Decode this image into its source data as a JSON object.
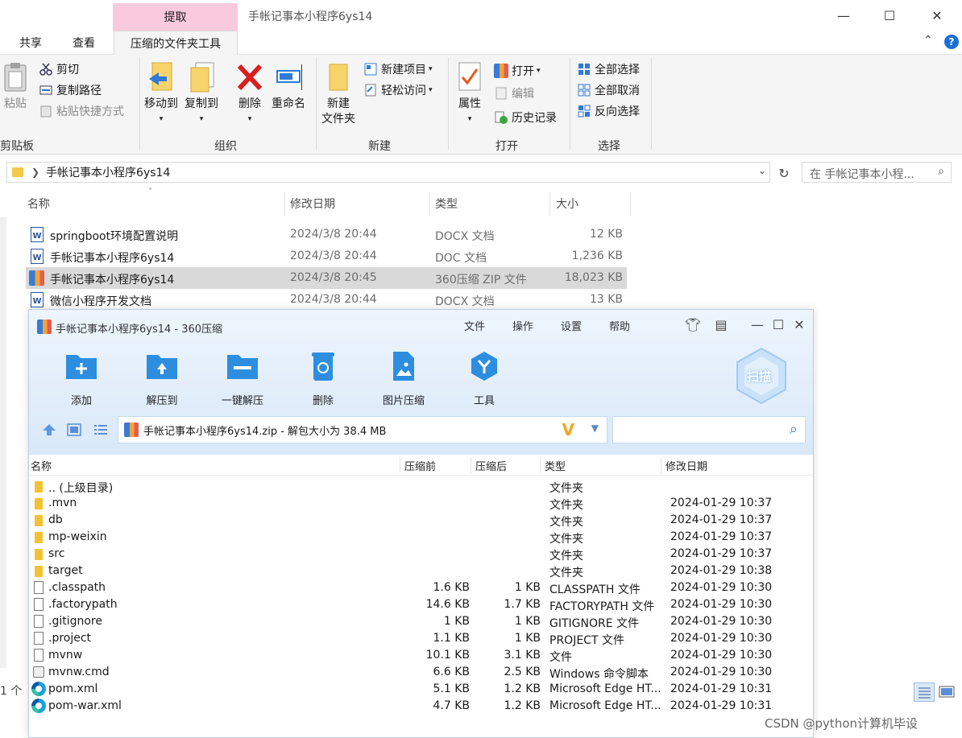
{
  "explorer": {
    "window_title": "手帐记事本小程序6ys14",
    "context_tab_header": "提取",
    "tabs": {
      "share": "共享",
      "view": "查看",
      "compressed_tools": "压缩的文件夹工具"
    },
    "ribbon": {
      "clipboard": {
        "paste": "粘贴",
        "cut": "剪切",
        "copy_path": "复制路径",
        "paste_shortcut": "粘贴快捷方式",
        "group": "剪贴板"
      },
      "organize": {
        "move_to": "移动到",
        "copy_to": "复制到",
        "delete": "删除",
        "rename": "重命名",
        "group": "组织"
      },
      "new": {
        "new_folder_line1": "新建",
        "new_folder_line2": "文件夹",
        "new_item": "新建项目",
        "easy_access": "轻松访问",
        "group": "新建"
      },
      "open": {
        "properties": "属性",
        "open": "打开",
        "edit": "编辑",
        "history": "历史记录",
        "group": "打开"
      },
      "select": {
        "select_all": "全部选择",
        "select_none": "全部取消",
        "invert": "反向选择",
        "group": "选择"
      }
    },
    "address": "手帐记事本小程序6ys14",
    "search_placeholder": "在 手帐记事本小程...",
    "columns": {
      "name": "名称",
      "modified": "修改日期",
      "type": "类型",
      "size": "大小"
    },
    "files": [
      {
        "name": "springboot环境配置说明",
        "modified": "2024/3/8 20:44",
        "type": "DOCX 文档",
        "size": "12 KB",
        "icon": "word-icon"
      },
      {
        "name": "手帐记事本小程序6ys14",
        "modified": "2024/3/8 20:44",
        "type": "DOC 文档",
        "size": "1,236 KB",
        "icon": "word-icon"
      },
      {
        "name": "手帐记事本小程序6ys14",
        "modified": "2024/3/8 20:45",
        "type": "360压缩 ZIP 文件",
        "size": "18,023 KB",
        "icon": "zip-icon",
        "selected": true
      },
      {
        "name": "微信小程序开发文档",
        "modified": "2024/3/8 20:44",
        "type": "DOCX 文档",
        "size": "13 KB",
        "icon": "word-icon"
      }
    ],
    "status_left": "1 个"
  },
  "zip": {
    "title": "手帐记事本小程序6ys14 - 360压缩",
    "menu": {
      "file": "文件",
      "operate": "操作",
      "settings": "设置",
      "help": "帮助"
    },
    "tools": {
      "add": "添加",
      "extract_to": "解压到",
      "one_click": "一键解压",
      "delete": "删除",
      "img_compress": "图片压缩",
      "tools": "工具"
    },
    "scan": "扫描",
    "path": "手帐记事本小程序6ys14.zip - 解包大小为 38.4 MB",
    "columns": {
      "name": "名称",
      "before": "压缩前",
      "after": "压缩后",
      "type": "类型",
      "modified": "修改日期"
    },
    "rows": [
      {
        "name": ".. (上级目录)",
        "before": "",
        "after": "",
        "type": "文件夹",
        "modified": "",
        "icon": "folder"
      },
      {
        "name": ".mvn",
        "before": "",
        "after": "",
        "type": "文件夹",
        "modified": "2024-01-29 10:37",
        "icon": "folder"
      },
      {
        "name": "db",
        "before": "",
        "after": "",
        "type": "文件夹",
        "modified": "2024-01-29 10:37",
        "icon": "folder"
      },
      {
        "name": "mp-weixin",
        "before": "",
        "after": "",
        "type": "文件夹",
        "modified": "2024-01-29 10:37",
        "icon": "folder"
      },
      {
        "name": "src",
        "before": "",
        "after": "",
        "type": "文件夹",
        "modified": "2024-01-29 10:37",
        "icon": "folder"
      },
      {
        "name": "target",
        "before": "",
        "after": "",
        "type": "文件夹",
        "modified": "2024-01-29 10:38",
        "icon": "folder"
      },
      {
        "name": ".classpath",
        "before": "1.6 KB",
        "after": "1 KB",
        "type": "CLASSPATH 文件",
        "modified": "2024-01-29 10:30",
        "icon": "doc"
      },
      {
        "name": ".factorypath",
        "before": "14.6 KB",
        "after": "1.7 KB",
        "type": "FACTORYPATH 文件",
        "modified": "2024-01-29 10:30",
        "icon": "doc"
      },
      {
        "name": ".gitignore",
        "before": "1 KB",
        "after": "1 KB",
        "type": "GITIGNORE 文件",
        "modified": "2024-01-29 10:30",
        "icon": "doc"
      },
      {
        "name": ".project",
        "before": "1.1 KB",
        "after": "1 KB",
        "type": "PROJECT 文件",
        "modified": "2024-01-29 10:30",
        "icon": "doc"
      },
      {
        "name": "mvnw",
        "before": "10.1 KB",
        "after": "3.1 KB",
        "type": "文件",
        "modified": "2024-01-29 10:30",
        "icon": "doc"
      },
      {
        "name": "mvnw.cmd",
        "before": "6.6 KB",
        "after": "2.5 KB",
        "type": "Windows 命令脚本",
        "modified": "2024-01-29 10:30",
        "icon": "cmd"
      },
      {
        "name": "pom.xml",
        "before": "5.1 KB",
        "after": "1.2 KB",
        "type": "Microsoft Edge HT...",
        "modified": "2024-01-29 10:31",
        "icon": "edge"
      },
      {
        "name": "pom-war.xml",
        "before": "4.7 KB",
        "after": "1.2 KB",
        "type": "Microsoft Edge HT...",
        "modified": "2024-01-29 10:31",
        "icon": "edge"
      }
    ]
  },
  "watermark": "CSDN @python计算机毕设"
}
